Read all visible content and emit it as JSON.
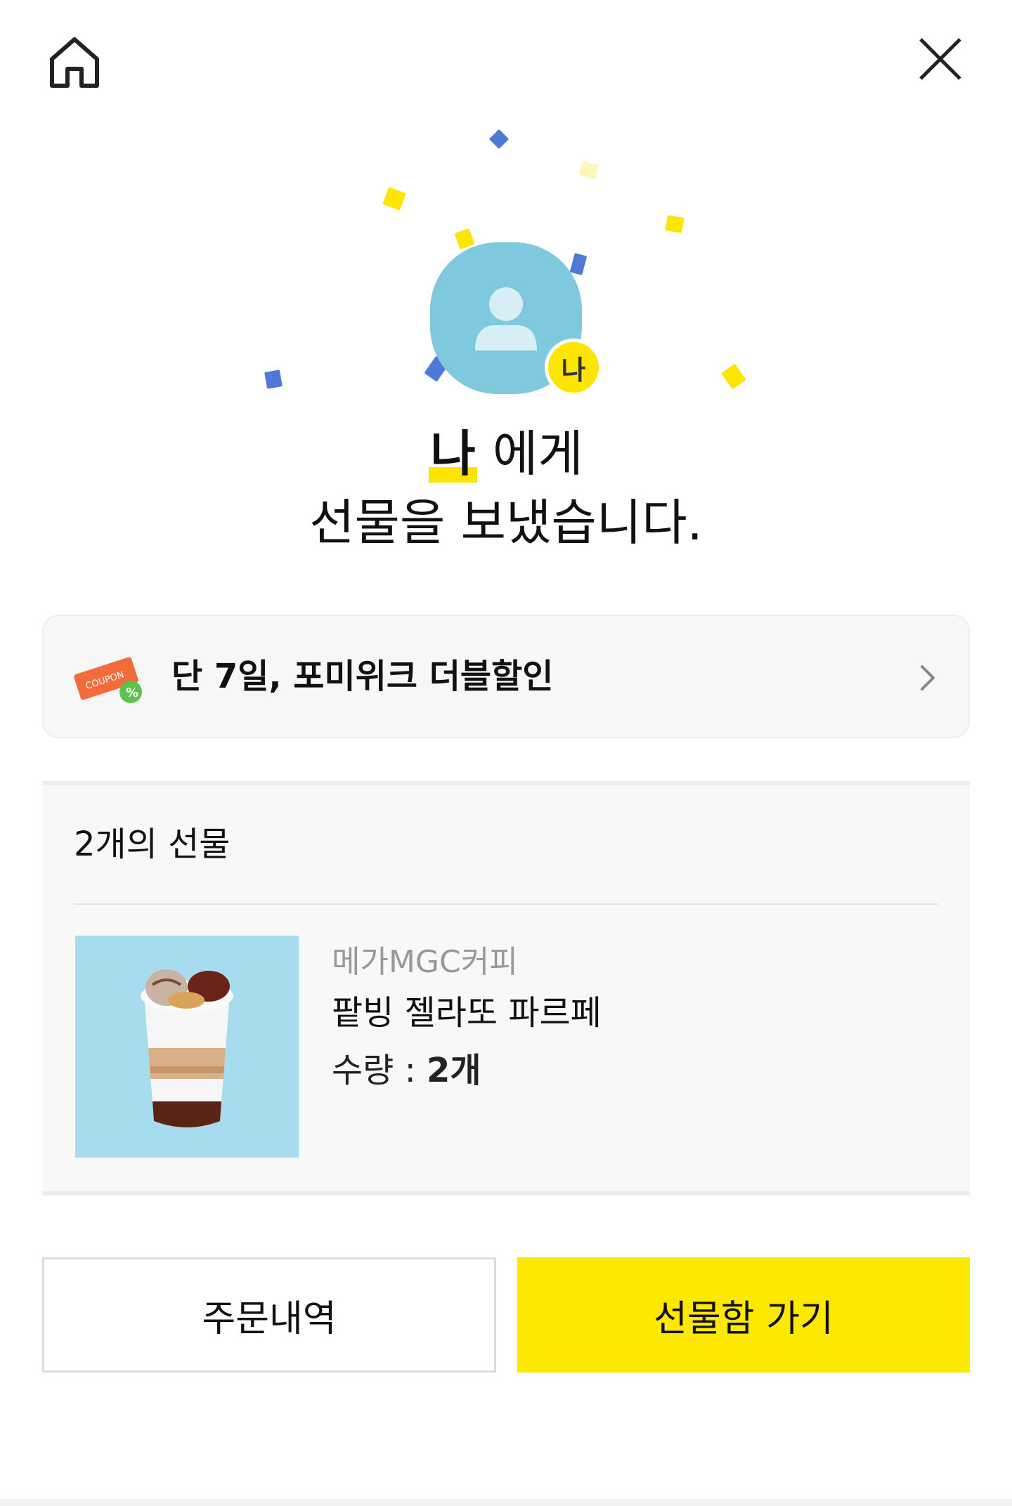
{
  "header": {
    "home_icon": "home-icon",
    "close_icon": "close-icon"
  },
  "recipient": {
    "badge": "나",
    "name": "나",
    "headline_suffix": " 에게",
    "headline_line2": "선물을 보냈습니다."
  },
  "promo": {
    "icon": "coupon-icon",
    "icon_text": "COUPON",
    "text": "단 7일, 포미위크 더블할인"
  },
  "gift": {
    "count_label": "2개의 선물",
    "items": [
      {
        "brand": "메가MGC커피",
        "name": "팥빙 젤라또 파르페",
        "qty_label": "수량 : ",
        "qty_value": "2개"
      }
    ]
  },
  "buttons": {
    "orders_label": "주문내역",
    "giftbox_label": "선물함 가기"
  },
  "colors": {
    "accent_yellow": "#fde800",
    "avatar_blue": "#7fc9df",
    "product_bg": "#a6dcee"
  }
}
